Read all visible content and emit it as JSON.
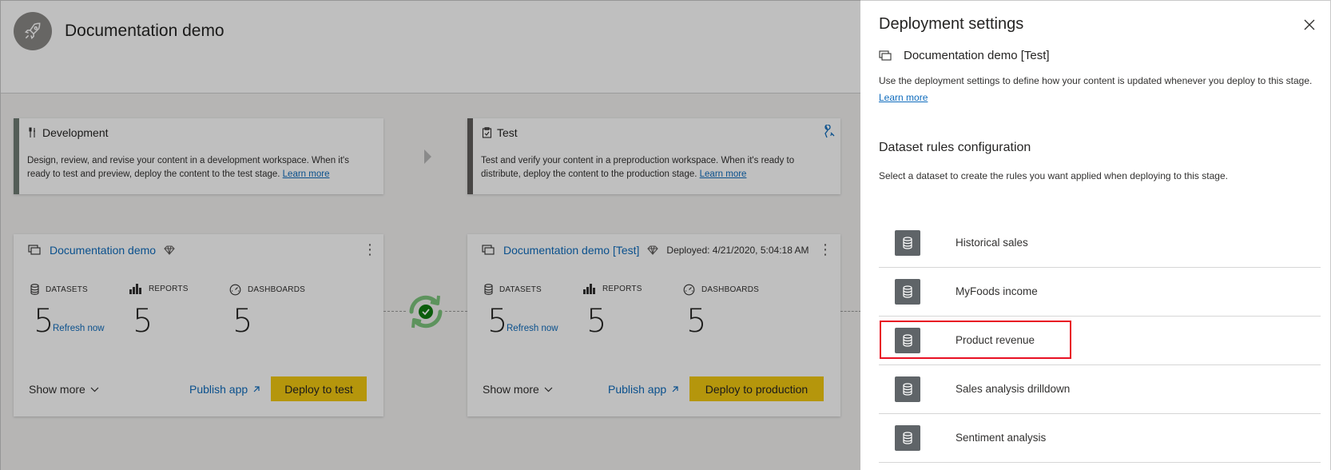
{
  "header": {
    "title": "Documentation demo"
  },
  "stages": [
    {
      "name": "Development",
      "description": "Design, review, and revise your content in a development workspace. When it's ready to test and preview, deploy the content to the test stage.",
      "learn_more": "Learn more"
    },
    {
      "name": "Test",
      "description": "Test and verify your content in a preproduction workspace. When it's ready to distribute, deploy the content to the production stage.",
      "learn_more": "Learn more"
    }
  ],
  "workspaces": [
    {
      "name": "Documentation demo",
      "deployed": "",
      "datasets_label": "DATASETS",
      "datasets": "5",
      "reports_label": "REPORTS",
      "reports": "5",
      "dashboards_label": "DASHBOARDS",
      "dashboards": "5",
      "refresh": "Refresh now",
      "show_more": "Show more",
      "publish": "Publish app",
      "deploy": "Deploy to test"
    },
    {
      "name": "Documentation demo [Test]",
      "deployed": "Deployed: 4/21/2020, 5:04:18 AM",
      "datasets_label": "DATASETS",
      "datasets": "5",
      "reports_label": "REPORTS",
      "reports": "5",
      "dashboards_label": "DASHBOARDS",
      "dashboards": "5",
      "refresh": "Refresh now",
      "show_more": "Show more",
      "publish": "Publish app",
      "deploy": "Deploy to production"
    }
  ],
  "panel": {
    "title": "Deployment settings",
    "workspace": "Documentation demo [Test]",
    "description": "Use the deployment settings to define how your content is updated whenever you deploy to this stage.",
    "learn_more": "Learn more",
    "section_title": "Dataset rules configuration",
    "section_desc": "Select a dataset to create the rules you want applied when deploying to this stage.",
    "datasets": [
      {
        "name": "Historical sales"
      },
      {
        "name": "MyFoods income"
      },
      {
        "name": "Product revenue",
        "highlighted": true
      },
      {
        "name": "Sales analysis drilldown"
      },
      {
        "name": "Sentiment analysis"
      }
    ]
  },
  "colors": {
    "accent": "#0f6cbd",
    "deploy": "#f2c811",
    "highlight": "#e81123",
    "stage_dev": "#6f7c74",
    "stage_test": "#605e5c",
    "success": "#107c10"
  }
}
